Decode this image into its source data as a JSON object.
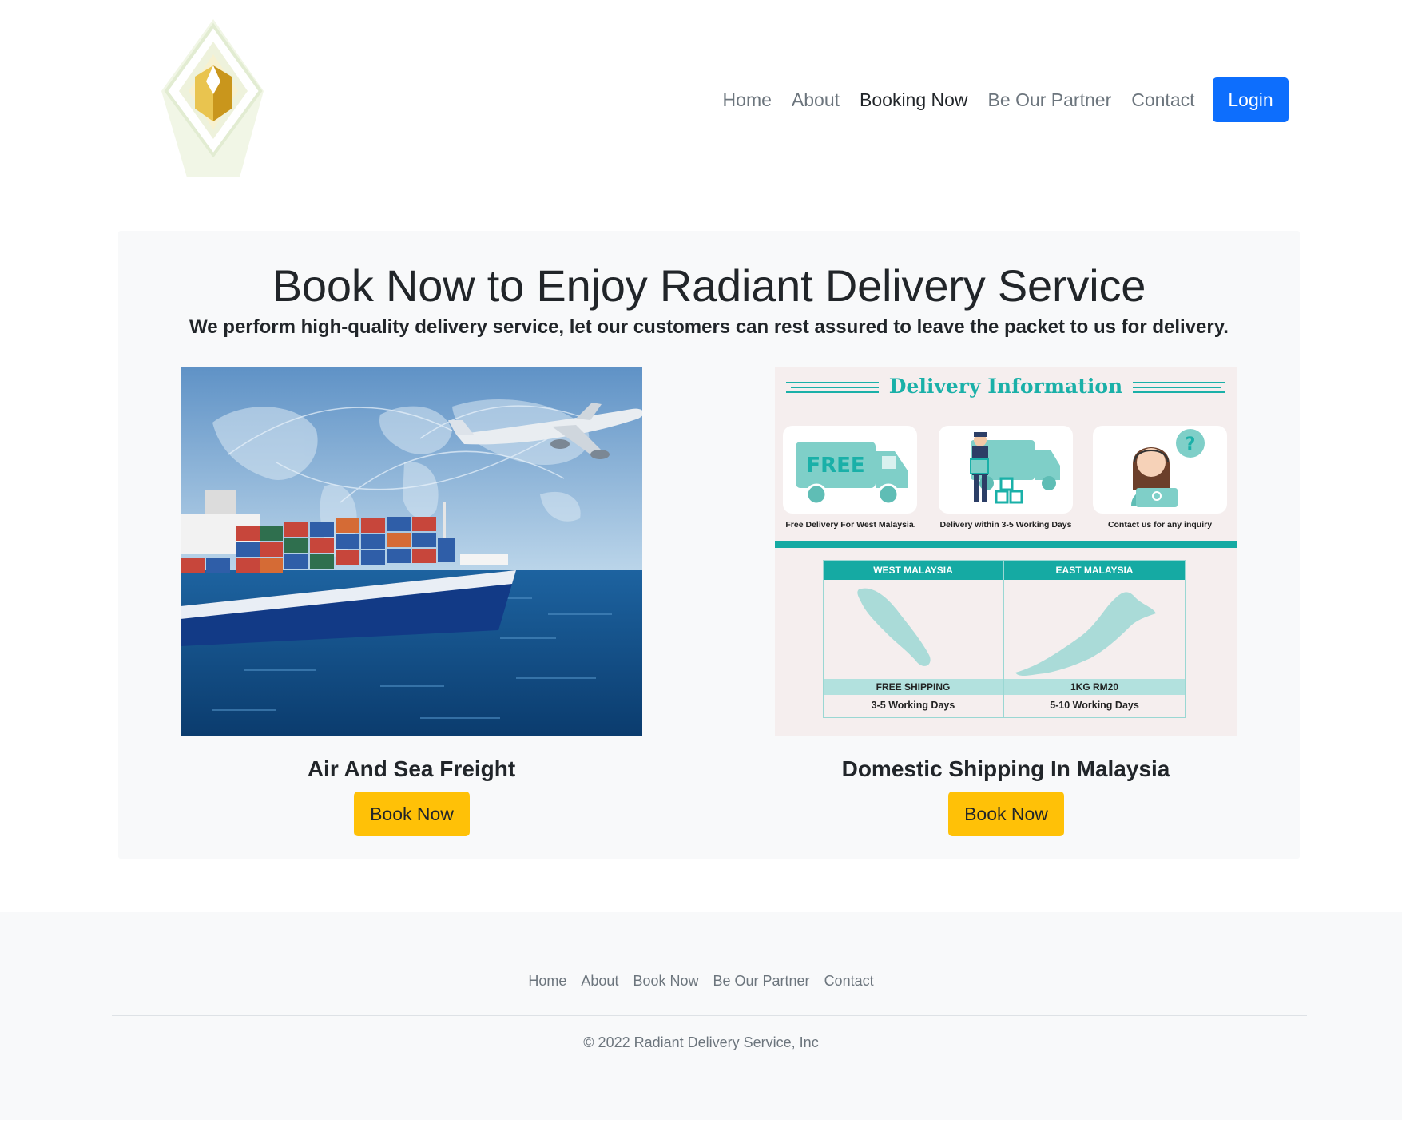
{
  "header": {
    "logo": "radiant-logo",
    "nav": [
      "Home",
      "About",
      "Booking Now",
      "Be Our Partner",
      "Contact"
    ],
    "active_nav": "Booking Now",
    "login_label": "Login"
  },
  "hero": {
    "title": "Book Now to Enjoy Radiant Delivery Service",
    "subtitle": "We perform high-quality delivery service, let our customers can rest assured to leave the packet to us for delivery."
  },
  "cards": [
    {
      "title": "Air And Sea Freight",
      "button": "Book Now",
      "image": "cargo-ship-and-airplane-image"
    },
    {
      "title": "Domestic Shipping In Malaysia",
      "button": "Book Now",
      "image": "delivery-information-image"
    }
  ],
  "delivery_info": {
    "title": "Delivery Information",
    "tiles": [
      {
        "icon": "free-van-icon",
        "badge": "FREE",
        "caption": "Free Delivery For West Malaysia."
      },
      {
        "icon": "delivery-man-icon",
        "caption": "Delivery within 3-5 Working Days"
      },
      {
        "icon": "support-agent-icon",
        "badge": "?",
        "caption": "Contact us for any inquiry"
      }
    ],
    "regions": [
      {
        "name": "WEST MALAYSIA",
        "price": "FREE SHIPPING",
        "days": "3-5 Working Days"
      },
      {
        "name": "EAST MALAYSIA",
        "price": "1KG RM20",
        "days": "5-10 Working Days"
      }
    ]
  },
  "footer": {
    "nav": [
      "Home",
      "About",
      "Book Now",
      "Be Our Partner",
      "Contact"
    ],
    "copyright": "© 2022 Radiant Delivery Service, Inc"
  },
  "colors": {
    "primary": "#0d6efd",
    "warning": "#ffc107",
    "teal": "#15aaa3",
    "panel": "#f8f9fa"
  }
}
